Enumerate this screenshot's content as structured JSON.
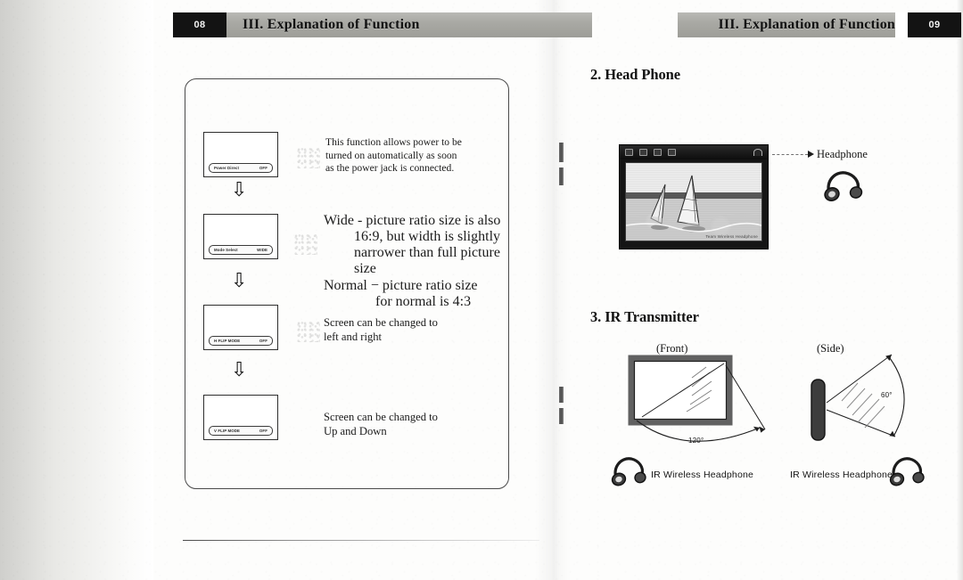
{
  "document": {
    "type": "scanned-manual-spread",
    "left_page": {
      "page_number": "08",
      "header_title": "III. Explanation of Function",
      "steps": [
        {
          "osd_label": "Power Direct",
          "osd_value": "OFF",
          "description_lines": [
            "This function allows power to be",
            "turned on automatically as soon",
            "as the power jack is connected."
          ]
        },
        {
          "osd_label": "Mode Select",
          "osd_value": "WIDE",
          "description_lines": [
            "Wide - picture ratio size is also",
            "16:9, but width is slightly",
            "narrower than full picture size",
            "Normal − picture ratio size",
            "for normal is 4:3"
          ]
        },
        {
          "osd_label": "H FLIP MODE",
          "osd_value": "OFF",
          "description_lines": [
            "Screen can be changed to",
            "left and right"
          ]
        },
        {
          "osd_label": "V FLIP MODE",
          "osd_value": "OFF",
          "description_lines": [
            "Screen can be changed to",
            "Up and Down"
          ]
        }
      ],
      "flow_arrow_glyph": "⇩"
    },
    "right_page": {
      "page_number": "09",
      "header_title": "III. Explanation of Function",
      "sections": [
        {
          "number_title": "2. Head Phone",
          "callout_label": "Headphone",
          "tv_caption": "Team Wireless Headphone",
          "illustration": "lcd-monitor-with-windsurfing-scene"
        },
        {
          "number_title": "3. IR Transmitter",
          "views": [
            {
              "caption": "(Front)",
              "angle": "120°",
              "device_caption": "IR Wireless Headphone"
            },
            {
              "caption": "(Side)",
              "angle": "60°",
              "device_caption": "IR Wireless Headphone"
            }
          ]
        }
      ]
    }
  },
  "colors": {
    "header_black": "#131313",
    "header_gray": "#a9a9a4",
    "ink": "#1a1a1a",
    "paper": "#fdfdfc"
  }
}
